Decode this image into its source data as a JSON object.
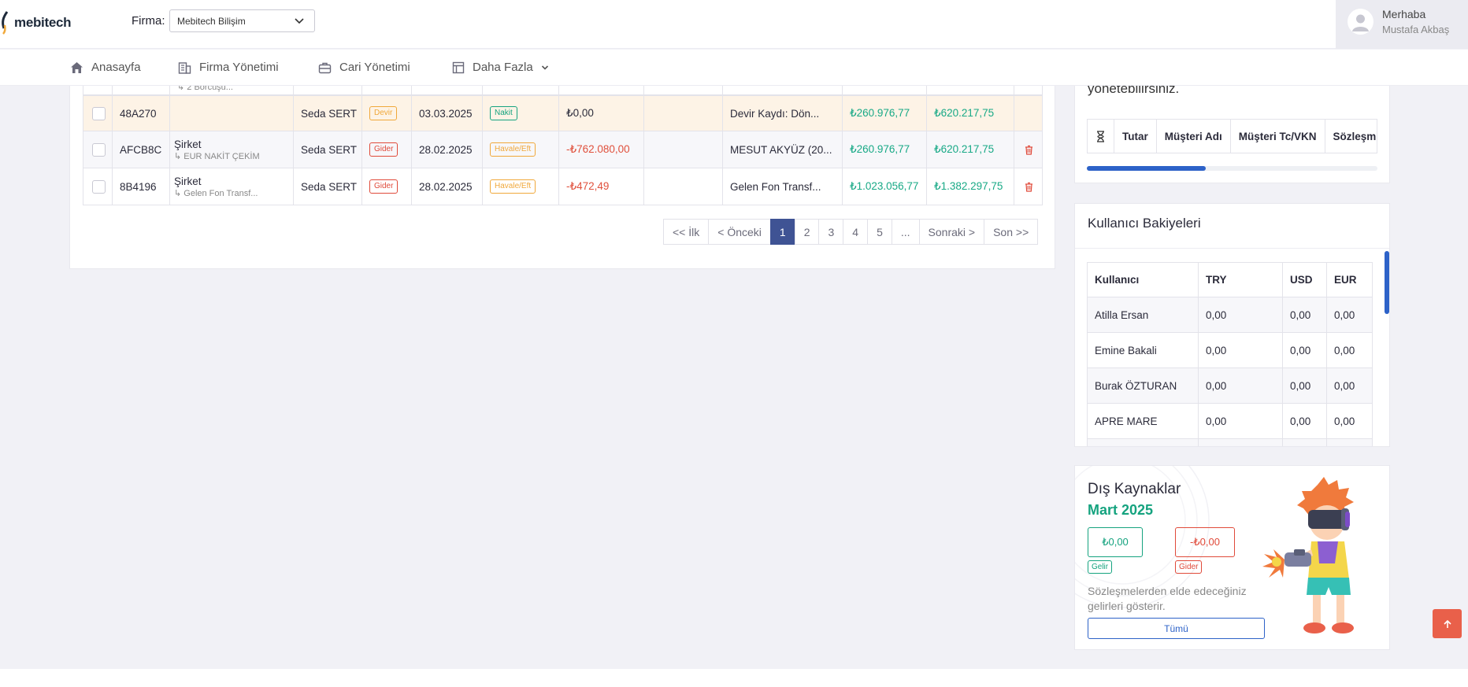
{
  "header": {
    "brand": "mebitech",
    "firma_label": "Firma:",
    "firma_value": "Mebitech Bilişim",
    "user_greeting": "Merhaba",
    "user_name": "Mustafa Akbaş"
  },
  "nav": {
    "items": [
      {
        "label": "Anasayfa",
        "icon": "home-icon"
      },
      {
        "label": "Firma Yönetimi",
        "icon": "building-icon"
      },
      {
        "label": "Cari Yönetimi",
        "icon": "briefcase-icon"
      },
      {
        "label": "Daha Fazla",
        "icon": "layout-icon"
      }
    ]
  },
  "transactions": {
    "cut_row_sub": "↳ 2 Borcuşu...",
    "rows": [
      {
        "code": "48A270",
        "account": "",
        "account_sub": "",
        "user": "Seda SERT",
        "type": "Devir",
        "date": "03.03.2025",
        "method": "Nakit",
        "amount": "₺0,00",
        "desc": "Devir Kaydı: Dön...",
        "balance1": "₺260.976,77",
        "balance2": "₺620.217,75"
      },
      {
        "code": "AFCB8C",
        "account": "Şirket",
        "account_sub": "↳ EUR NAKİT ÇEKİM",
        "user": "Seda SERT",
        "type": "Gider",
        "date": "28.02.2025",
        "method": "Havale/Eft",
        "amount": "-₺762.080,00",
        "desc": "MESUT AKYÜZ (20...",
        "balance1": "₺260.976,77",
        "balance2": "₺620.217,75"
      },
      {
        "code": "8B4196",
        "account": "Şirket",
        "account_sub": "↳ Gelen Fon Transf...",
        "user": "Seda SERT",
        "type": "Gider",
        "date": "28.02.2025",
        "method": "Havale/Eft",
        "amount": "-₺472,49",
        "desc": "Gelen Fon Transf...",
        "balance1": "₺1.023.056,77",
        "balance2": "₺1.382.297,75"
      }
    ]
  },
  "pagination": {
    "first": "<< İlk",
    "prev": "< Önceki",
    "pages": [
      "1",
      "2",
      "3",
      "4",
      "5",
      "..."
    ],
    "next": "Sonraki >",
    "last": "Son >>",
    "active": "1"
  },
  "contracts_card": {
    "cut_title": "yönetebilirsiniz.",
    "columns": [
      "Tutar",
      "Müşteri Adı",
      "Müşteri Tc/VKN",
      "Sözleşm"
    ],
    "scroll_progress": 0.41
  },
  "user_balances": {
    "title": "Kullanıcı Bakiyeleri",
    "headers": [
      "Kullanıcı",
      "TRY",
      "USD",
      "EUR"
    ],
    "rows": [
      [
        "Atilla Ersan",
        "0,00",
        "0,00",
        "0,00"
      ],
      [
        "Emine Bakali",
        "0,00",
        "0,00",
        "0,00"
      ],
      [
        "Burak ÖZTURAN",
        "0,00",
        "0,00",
        "0,00"
      ],
      [
        "APRE MARE",
        "0,00",
        "0,00",
        "0,00"
      ]
    ]
  },
  "external": {
    "title": "Dış Kaynaklar",
    "month": "Mart 2025",
    "income_amount": "₺0,00",
    "income_label": "Gelir",
    "expense_amount": "-₺0,00",
    "expense_label": "Gider",
    "description": "Sözleşmelerden elde edeceğiniz gelirleri gösterir.",
    "button": "Tümü"
  },
  "colors": {
    "accent": "#2d62c8",
    "positive": "#15a37f",
    "negative": "#e04a3a",
    "warning": "#f0a83a",
    "pager_active": "#3f5394"
  }
}
